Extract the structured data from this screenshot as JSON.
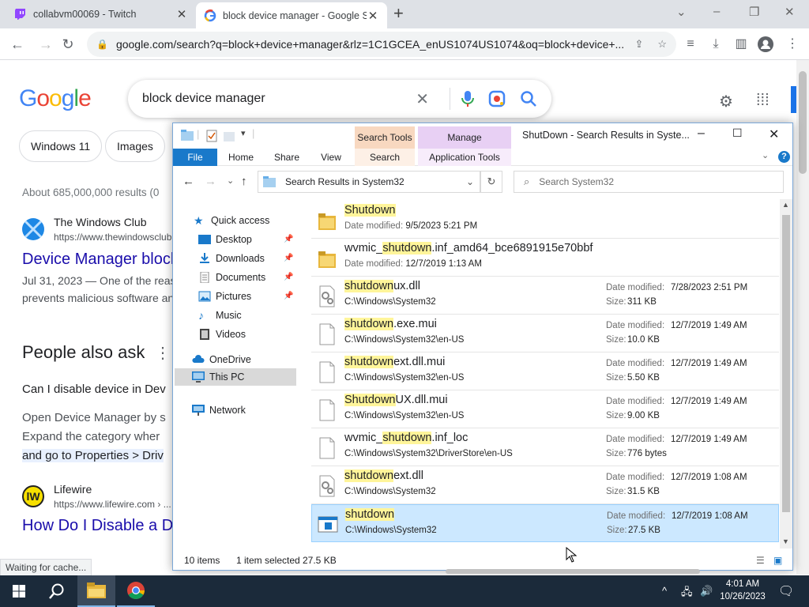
{
  "browser": {
    "tabs": [
      {
        "title": "collabvm00069 - Twitch"
      },
      {
        "title": "block device manager - Google S"
      }
    ],
    "url": "google.com/search?q=block+device+manager&rlz=1C1GCEA_enUS1074US1074&oq=block+device+..."
  },
  "google": {
    "logo": "Google",
    "query": "block device manager",
    "chips": [
      "Windows 11",
      "Images"
    ],
    "result_count": "About 685,000,000 results (0",
    "results": [
      {
        "site": "The Windows Club",
        "url": "https://www.thewindowsclub",
        "title": "Device Manager block",
        "snippet1": "Jul 31, 2023 — One of the reas",
        "snippet2": "prevents malicious software an"
      },
      {
        "site": "Lifewire",
        "url": "https://www.lifewire.com › ...",
        "title": "How Do I Disable a D"
      }
    ],
    "people_also_ask": "People also ask",
    "paa_question": "Can I disable device in Dev",
    "paa_line1": "Open Device Manager by s",
    "paa_line2": "Expand the category wher",
    "paa_line3": "and go to Properties > Driv",
    "status": "Waiting for cache..."
  },
  "explorer": {
    "title": "ShutDown - Search Results in Syste...",
    "context_headers": [
      "Search Tools",
      "Manage"
    ],
    "ribbon_tabs": [
      "File",
      "Home",
      "Share",
      "View",
      "Search",
      "Application Tools"
    ],
    "path": "Search Results in System32",
    "search_placeholder": "Search System32",
    "nav": [
      {
        "label": "Quick access"
      },
      {
        "label": "Desktop"
      },
      {
        "label": "Downloads"
      },
      {
        "label": "Documents"
      },
      {
        "label": "Pictures"
      },
      {
        "label": "Music"
      },
      {
        "label": "Videos"
      },
      {
        "label": "OneDrive"
      },
      {
        "label": "This PC"
      },
      {
        "label": "Network"
      }
    ],
    "files": [
      {
        "pre": "",
        "hl": "Shutdown",
        "post": "",
        "sub_label": "Date modified:",
        "sub_value": "9/5/2023 5:21 PM",
        "icon": "folder-icon"
      },
      {
        "pre": "wvmic_",
        "hl": "shutdown",
        "post": ".inf_amd64_bce6891915e70bbf",
        "sub_label": "Date modified:",
        "sub_value": "12/7/2019 1:13 AM",
        "icon": "folder-icon"
      },
      {
        "pre": "",
        "hl": "shutdown",
        "post": "ux.dll",
        "path": "C:\\Windows\\System32",
        "date": "7/28/2023 2:51 PM",
        "size": "311 KB",
        "icon": "dll-icon"
      },
      {
        "pre": "",
        "hl": "shutdown",
        "post": ".exe.mui",
        "path": "C:\\Windows\\System32\\en-US",
        "date": "12/7/2019 1:49 AM",
        "size": "10.0 KB",
        "icon": "file-icon"
      },
      {
        "pre": "",
        "hl": "shutdown",
        "post": "ext.dll.mui",
        "path": "C:\\Windows\\System32\\en-US",
        "date": "12/7/2019 1:49 AM",
        "size": "5.50 KB",
        "icon": "file-icon"
      },
      {
        "pre": "",
        "hl": "Shutdown",
        "post": "UX.dll.mui",
        "path": "C:\\Windows\\System32\\en-US",
        "date": "12/7/2019 1:49 AM",
        "size": "9.00 KB",
        "icon": "file-icon"
      },
      {
        "pre": "wvmic_",
        "hl": "shutdown",
        "post": ".inf_loc",
        "path": "C:\\Windows\\System32\\DriverStore\\en-US",
        "date": "12/7/2019 1:49 AM",
        "size": "776 bytes",
        "icon": "file-icon"
      },
      {
        "pre": "",
        "hl": "shutdown",
        "post": "ext.dll",
        "path": "C:\\Windows\\System32",
        "date": "12/7/2019 1:08 AM",
        "size": "31.5 KB",
        "icon": "dll-icon"
      },
      {
        "pre": "",
        "hl": "shutdown",
        "post": "",
        "path": "C:\\Windows\\System32",
        "date": "12/7/2019 1:08 AM",
        "size": "27.5 KB",
        "icon": "exe-icon",
        "selected": true
      }
    ],
    "date_label": "Date modified:",
    "size_label": "Size:",
    "status_items": "10 items",
    "status_selected": "1 item selected",
    "status_size": "27.5 KB"
  },
  "taskbar": {
    "time": "4:01 AM",
    "date": "10/26/2023"
  },
  "colors": {
    "selection": "#cce8ff",
    "highlight": "#fff59a",
    "file_tab": "#1979ca",
    "search_tools": "#f8d8c0",
    "manage": "#e8d0f4",
    "taskbar": "#1b2a3a"
  }
}
